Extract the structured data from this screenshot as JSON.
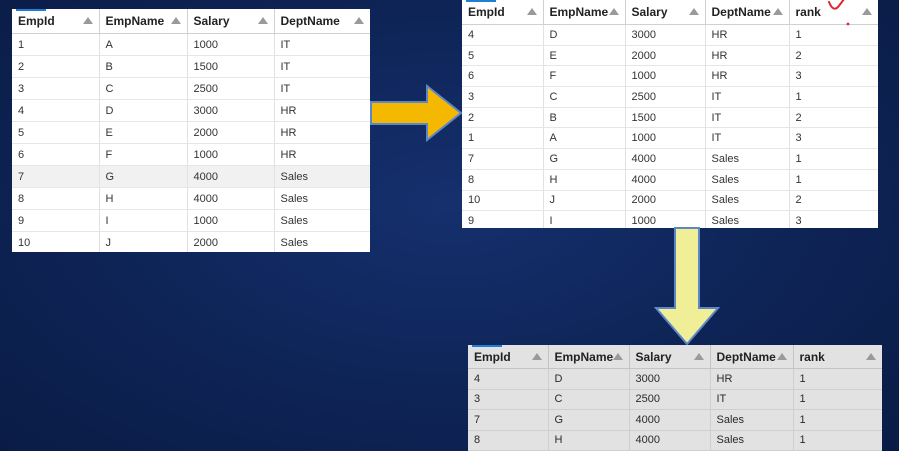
{
  "colors": {
    "background": "#0e2456",
    "arrow_fill": "#f5b800",
    "arrow_down_fill": "#f0ef98",
    "annotation": "#e0262b"
  },
  "source_table": {
    "columns": [
      "EmpId",
      "EmpName",
      "Salary",
      "DeptName"
    ],
    "rows": [
      [
        "1",
        "A",
        "1000",
        "IT"
      ],
      [
        "2",
        "B",
        "1500",
        "IT"
      ],
      [
        "3",
        "C",
        "2500",
        "IT"
      ],
      [
        "4",
        "D",
        "3000",
        "HR"
      ],
      [
        "5",
        "E",
        "2000",
        "HR"
      ],
      [
        "6",
        "F",
        "1000",
        "HR"
      ],
      [
        "7",
        "G",
        "4000",
        "Sales"
      ],
      [
        "8",
        "H",
        "4000",
        "Sales"
      ],
      [
        "9",
        "I",
        "1000",
        "Sales"
      ],
      [
        "10",
        "J",
        "2000",
        "Sales"
      ]
    ]
  },
  "ranked_table": {
    "columns": [
      "EmpId",
      "EmpName",
      "Salary",
      "DeptName",
      "rank"
    ],
    "rows": [
      [
        "4",
        "D",
        "3000",
        "HR",
        "1"
      ],
      [
        "5",
        "E",
        "2000",
        "HR",
        "2"
      ],
      [
        "6",
        "F",
        "1000",
        "HR",
        "3"
      ],
      [
        "3",
        "C",
        "2500",
        "IT",
        "1"
      ],
      [
        "2",
        "B",
        "1500",
        "IT",
        "2"
      ],
      [
        "1",
        "A",
        "1000",
        "IT",
        "3"
      ],
      [
        "7",
        "G",
        "4000",
        "Sales",
        "1"
      ],
      [
        "8",
        "H",
        "4000",
        "Sales",
        "1"
      ],
      [
        "10",
        "J",
        "2000",
        "Sales",
        "2"
      ],
      [
        "9",
        "I",
        "1000",
        "Sales",
        "3"
      ]
    ]
  },
  "filtered_table": {
    "columns": [
      "EmpId",
      "EmpName",
      "Salary",
      "DeptName",
      "rank"
    ],
    "rows": [
      [
        "4",
        "D",
        "3000",
        "HR",
        "1"
      ],
      [
        "3",
        "C",
        "2500",
        "IT",
        "1"
      ],
      [
        "7",
        "G",
        "4000",
        "Sales",
        "1"
      ],
      [
        "8",
        "H",
        "4000",
        "Sales",
        "1"
      ]
    ]
  }
}
